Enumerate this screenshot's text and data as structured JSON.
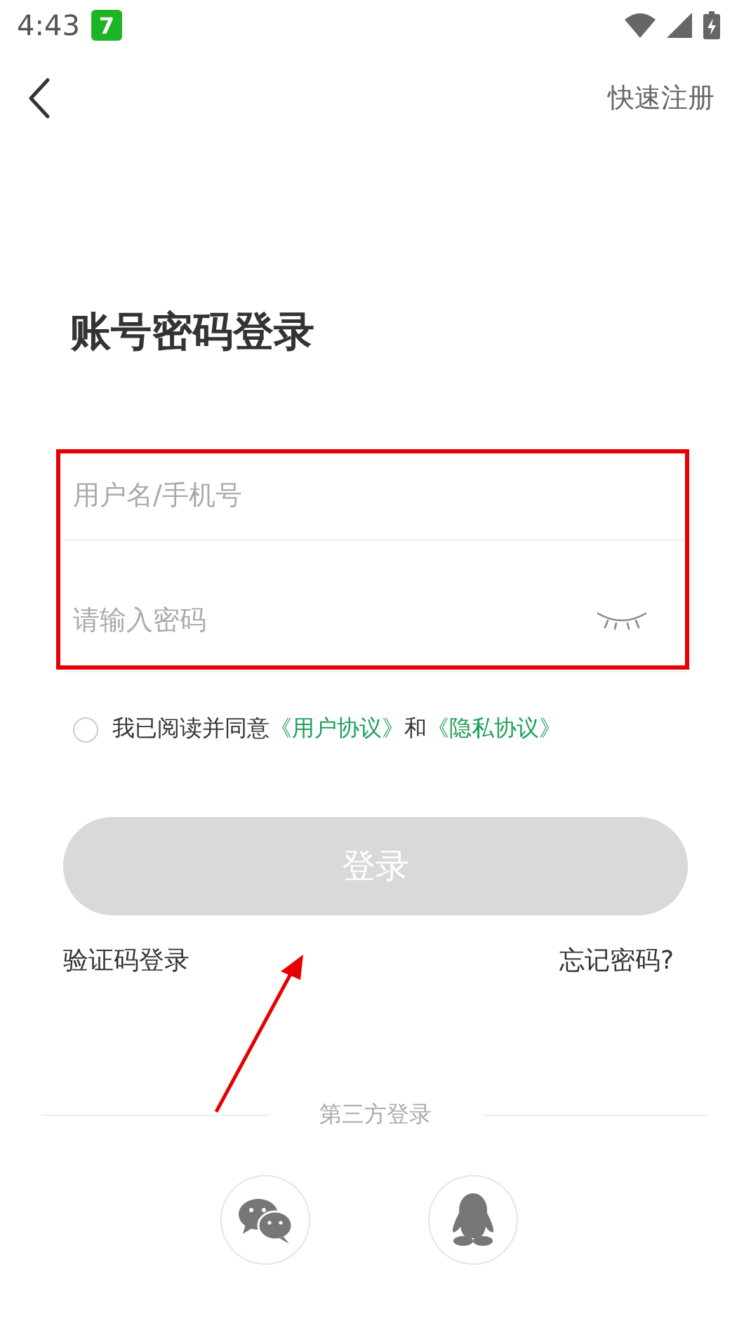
{
  "status_bar": {
    "time": "4:43",
    "app_badge": "7"
  },
  "nav": {
    "register": "快速注册"
  },
  "title": "账号密码登录",
  "fields": [
    {
      "kind": "text",
      "placeholder": "用户名/手机号"
    },
    {
      "kind": "password",
      "placeholder": "请输入密码"
    }
  ],
  "agreement": {
    "checked": false,
    "parts": [
      {
        "kind": "text",
        "text": "我已阅读并同意"
      },
      {
        "kind": "link",
        "text": "《用户协议》"
      },
      {
        "kind": "text",
        "text": "和"
      },
      {
        "kind": "link",
        "text": "《隐私协议》"
      }
    ]
  },
  "login_button": {
    "label": "登录",
    "disabled": true
  },
  "links": [
    "验证码登录",
    "忘记密码?"
  ],
  "third_party": {
    "label": "第三方登录",
    "providers": [
      {
        "kind": "wechat"
      },
      {
        "kind": "qq"
      }
    ]
  }
}
